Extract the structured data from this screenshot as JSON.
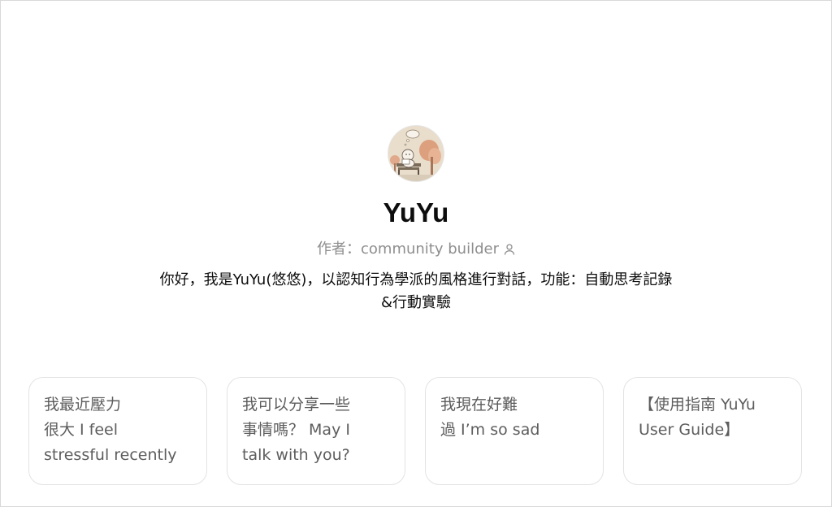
{
  "gpt": {
    "name": "YuYu",
    "author_prefix": "作者：",
    "author_name": "community builder",
    "description": "你好，我是YuYu(悠悠)，以認知行為學派的風格進行對話，功能：自動思考記錄&行動實驗",
    "avatar_icon": "bench-reading-avatar-icon"
  },
  "conversation_starters": [
    {
      "label": "我最近壓力\n很大 I feel\nstressful recently"
    },
    {
      "label": "我可以分享一些\n事情嗎？ May I\ntalk with you?"
    },
    {
      "label": "我現在好難\n過 I’m so sad"
    },
    {
      "label": "【使用指南 YuYu\nUser Guide】"
    }
  ],
  "colors": {
    "text_primary": "#0d0d0d",
    "text_secondary": "#8e8e8e",
    "card_text": "#5d5d5d",
    "card_border": "#e3e3e3",
    "avatar_bg": "#e9ddcc"
  }
}
